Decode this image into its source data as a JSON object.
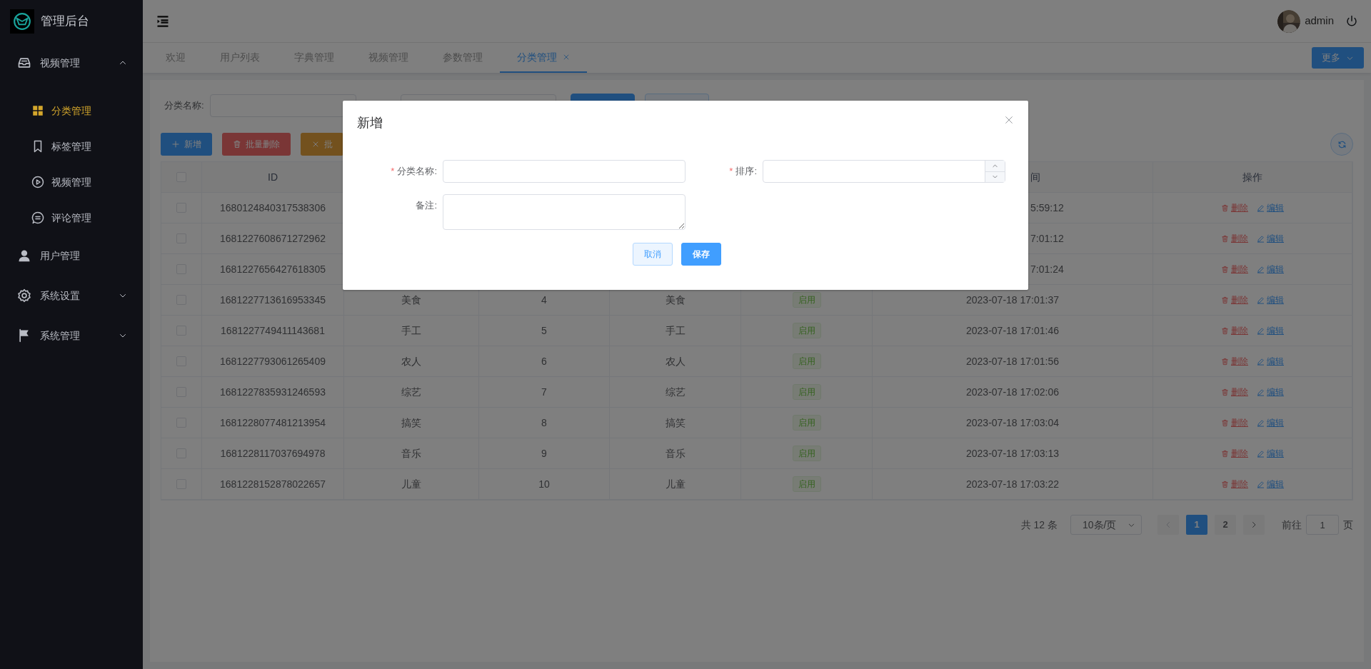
{
  "sidebar": {
    "logo_text": "管理后台",
    "menu": [
      {
        "label": "视频管理",
        "selected": false,
        "expanded": true,
        "children": [
          {
            "label": "分类管理",
            "selected": true
          },
          {
            "label": "标签管理",
            "selected": false
          },
          {
            "label": "视频管理",
            "selected": false
          },
          {
            "label": "评论管理",
            "selected": false
          }
        ]
      },
      {
        "label": "用户管理",
        "selected": false
      },
      {
        "label": "系统设置",
        "selected": false,
        "expanded": false
      },
      {
        "label": "系统管理",
        "selected": false,
        "expanded": false
      }
    ]
  },
  "header": {
    "username": "admin"
  },
  "tabs": [
    {
      "label": "欢迎",
      "selected": false,
      "closable": false
    },
    {
      "label": "用户列表",
      "selected": false,
      "closable": false
    },
    {
      "label": "字典管理",
      "selected": false,
      "closable": false
    },
    {
      "label": "视频管理",
      "selected": false,
      "closable": false
    },
    {
      "label": "参数管理",
      "selected": false,
      "closable": false
    },
    {
      "label": "分类管理",
      "selected": true,
      "closable": true
    }
  ],
  "more_button": "更多",
  "filter": {
    "label": "分类名称:"
  },
  "toolbar": [
    {
      "label": "新增",
      "kind": "primary"
    },
    {
      "label": "批量删除",
      "kind": "danger"
    },
    {
      "label": "批",
      "kind": "warning"
    }
  ],
  "table": {
    "header_checked": false,
    "columns": [
      "ID",
      "间",
      "操作"
    ],
    "rows": [
      {
        "checked": false,
        "id": "1680124840317538306",
        "time": "5:59:12",
        "delete": "删除",
        "edit": "编辑"
      },
      {
        "checked": false,
        "id": "1681227608671272962",
        "time": "7:01:12",
        "delete": "删除",
        "edit": "编辑"
      },
      {
        "checked": false,
        "id": "1681227656427618305",
        "time": "7:01:24",
        "delete": "删除",
        "edit": "编辑"
      },
      {
        "checked": false,
        "id": "1681227713616953345",
        "name": "美食",
        "sort": "4",
        "remark": "美食",
        "status": "启用",
        "time": "2023-07-18 17:01:37",
        "delete": "删除",
        "edit": "编辑"
      },
      {
        "checked": false,
        "id": "1681227749411143681",
        "name": "手工",
        "sort": "5",
        "remark": "手工",
        "status": "启用",
        "time": "2023-07-18 17:01:46",
        "delete": "删除",
        "edit": "编辑"
      },
      {
        "checked": false,
        "id": "1681227793061265409",
        "name": "农人",
        "sort": "6",
        "remark": "农人",
        "status": "启用",
        "time": "2023-07-18 17:01:56",
        "delete": "删除",
        "edit": "编辑"
      },
      {
        "checked": false,
        "id": "1681227835931246593",
        "name": "综艺",
        "sort": "7",
        "remark": "综艺",
        "status": "启用",
        "time": "2023-07-18 17:02:06",
        "delete": "删除",
        "edit": "编辑"
      },
      {
        "checked": false,
        "id": "1681228077481213954",
        "name": "搞笑",
        "sort": "8",
        "remark": "搞笑",
        "status": "启用",
        "time": "2023-07-18 17:03:04",
        "delete": "删除",
        "edit": "编辑"
      },
      {
        "checked": false,
        "id": "1681228117037694978",
        "name": "音乐",
        "sort": "9",
        "remark": "音乐",
        "status": "启用",
        "time": "2023-07-18 17:03:13",
        "delete": "删除",
        "edit": "编辑"
      },
      {
        "checked": false,
        "id": "1681228152878022657",
        "name": "儿童",
        "sort": "10",
        "remark": "儿童",
        "status": "启用",
        "time": "2023-07-18 17:03:22",
        "delete": "删除",
        "edit": "编辑"
      }
    ]
  },
  "pagination": {
    "total": "共 12 条",
    "page_size": "10条/页",
    "pages": [
      {
        "label": "1",
        "selected": true
      },
      {
        "label": "2",
        "selected": false
      }
    ],
    "goto_label": "前往",
    "goto_value": "1",
    "goto_suffix": "页"
  },
  "dialog": {
    "title": "新增",
    "required_mark": "*",
    "fields": [
      {
        "label": "分类名称:",
        "required": true,
        "kind": "text"
      },
      {
        "label": "排序:",
        "required": true,
        "kind": "number"
      },
      {
        "label": "备注:",
        "required": false,
        "kind": "textarea"
      }
    ],
    "buttons": [
      {
        "label": "取消",
        "kind": "default"
      },
      {
        "label": "保存",
        "kind": "primary"
      }
    ]
  }
}
